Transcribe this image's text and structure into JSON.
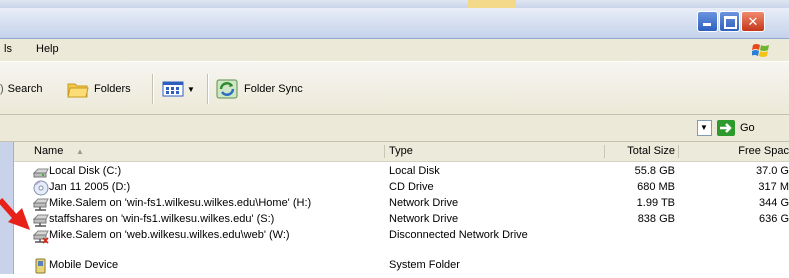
{
  "menubar": {
    "items": [
      "ls",
      "Help"
    ]
  },
  "toolbar": {
    "search_label": "Search",
    "folders_label": "Folders",
    "folder_sync_label": "Folder Sync"
  },
  "address": {
    "go_label": "Go"
  },
  "columns": {
    "name": "Name",
    "type": "Type",
    "total": "Total Size",
    "free": "Free Spac"
  },
  "rows": [
    {
      "icon": "local-disk-icon",
      "name": "Local Disk (C:)",
      "type": "Local Disk",
      "total": "55.8 GB",
      "free": "37.0 G"
    },
    {
      "icon": "cd-drive-icon",
      "name": "Jan 11 2005 (D:)",
      "type": "CD Drive",
      "total": "680 MB",
      "free": "317 M"
    },
    {
      "icon": "network-drive-icon",
      "name": "Mike.Salem on 'win-fs1.wilkesu.wilkes.edu\\Home' (H:)",
      "type": "Network Drive",
      "total": "1.99 TB",
      "free": "344 G"
    },
    {
      "icon": "network-drive-icon",
      "name": "staffshares on 'win-fs1.wilkesu.wilkes.edu' (S:)",
      "type": "Network Drive",
      "total": "838 GB",
      "free": "636 G"
    },
    {
      "icon": "disconnected-drive-icon",
      "name": "Mike.Salem on 'web.wilkesu.wilkes.edu\\web' (W:)",
      "type": "Disconnected Network Drive",
      "total": "",
      "free": ""
    },
    {
      "icon": "mobile-device-icon",
      "name": "Mobile Device",
      "type": "System Folder",
      "total": "",
      "free": ""
    }
  ],
  "colors": {
    "arrow": "#e8201a",
    "titlebar": "#c4d2ea",
    "menu_bg": "#ece9d8"
  }
}
